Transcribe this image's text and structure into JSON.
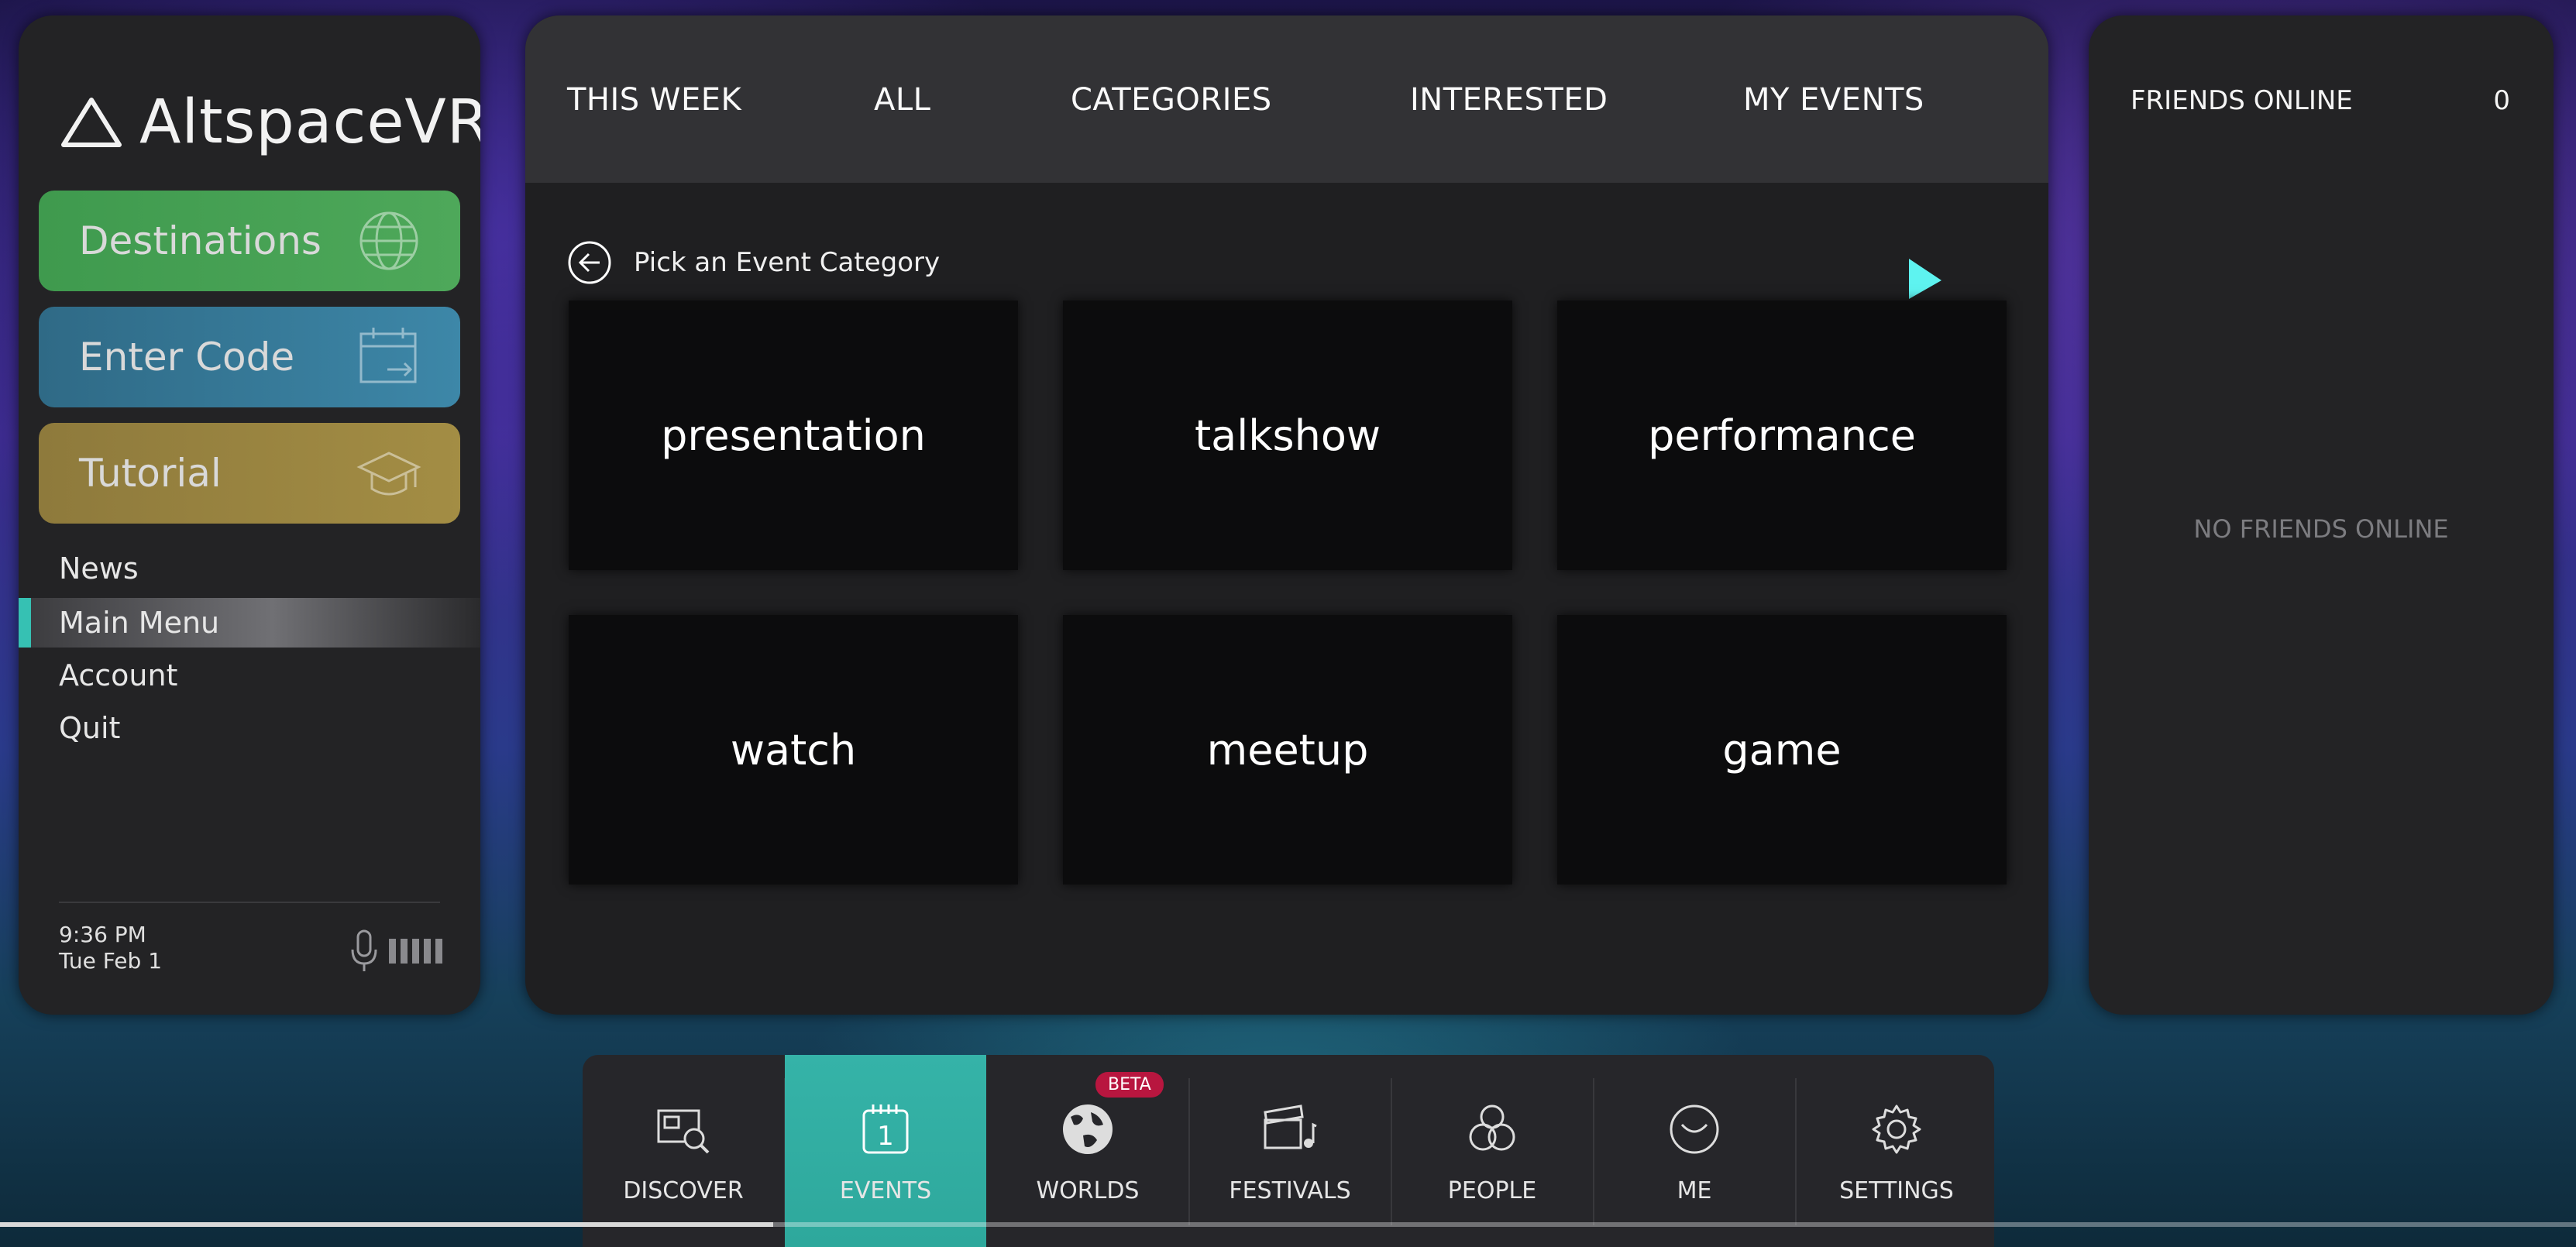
{
  "app": {
    "name": "AltspaceVR"
  },
  "sidebar": {
    "buttons": [
      {
        "label": "Destinations",
        "icon": "globe-icon"
      },
      {
        "label": "Enter Code",
        "icon": "calendar-arrow-icon"
      },
      {
        "label": "Tutorial",
        "icon": "graduation-cap-icon"
      }
    ],
    "menu": [
      "News",
      "Main Menu",
      "Account",
      "Quit"
    ],
    "active_menu": "Main Menu",
    "time": "9:36 PM",
    "date": "Tue Feb 1"
  },
  "tabs": [
    "THIS WEEK",
    "ALL",
    "CATEGORIES",
    "INTERESTED",
    "MY EVENTS"
  ],
  "content": {
    "heading": "Pick an Event Category",
    "categories": [
      "presentation",
      "talkshow",
      "performance",
      "watch",
      "meetup",
      "game"
    ]
  },
  "friends": {
    "title": "FRIENDS ONLINE",
    "count": "0",
    "empty_text": "NO FRIENDS ONLINE"
  },
  "dock": {
    "items": [
      {
        "label": "DISCOVER",
        "icon": "discover-icon"
      },
      {
        "label": "EVENTS",
        "icon": "events-calendar-icon"
      },
      {
        "label": "WORLDS",
        "icon": "globe-icon"
      },
      {
        "label": "FESTIVALS",
        "icon": "festivals-icon"
      },
      {
        "label": "PEOPLE",
        "icon": "people-icon"
      },
      {
        "label": "ME",
        "icon": "smiley-icon"
      },
      {
        "label": "SETTINGS",
        "icon": "gear-icon"
      }
    ],
    "active": "EVENTS",
    "beta_label": "BETA"
  },
  "colors": {
    "accent": "#36c1b3",
    "destinations": "#45a152",
    "enter_code": "#3479a0",
    "tutorial": "#9a8540",
    "beta": "#b8163f"
  },
  "playback_progress": 0.3
}
